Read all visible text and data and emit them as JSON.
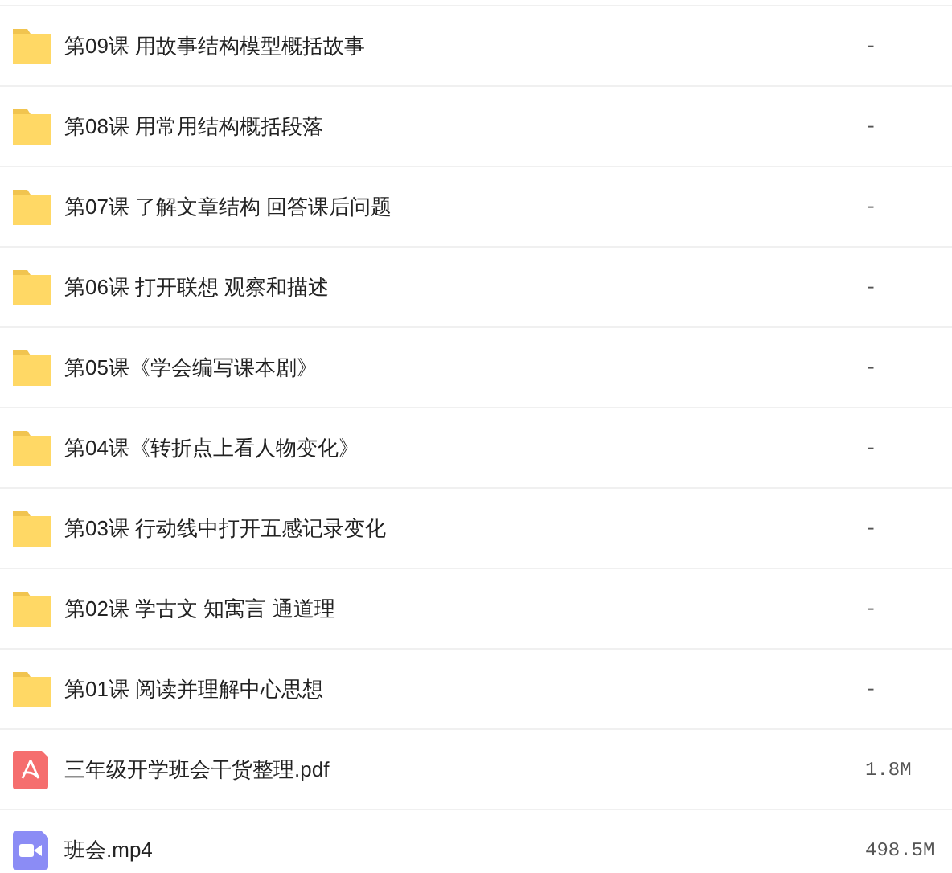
{
  "files": [
    {
      "kind": "folder",
      "name": "第09课 用故事结构模型概括故事",
      "size": "-"
    },
    {
      "kind": "folder",
      "name": "第08课 用常用结构概括段落",
      "size": "-"
    },
    {
      "kind": "folder",
      "name": "第07课 了解文章结构 回答课后问题",
      "size": "-"
    },
    {
      "kind": "folder",
      "name": "第06课 打开联想 观察和描述",
      "size": "-"
    },
    {
      "kind": "folder",
      "name": "第05课《学会编写课本剧》",
      "size": "-"
    },
    {
      "kind": "folder",
      "name": "第04课《转折点上看人物变化》",
      "size": "-"
    },
    {
      "kind": "folder",
      "name": "第03课 行动线中打开五感记录变化",
      "size": "-"
    },
    {
      "kind": "folder",
      "name": "第02课 学古文 知寓言 通道理",
      "size": "-"
    },
    {
      "kind": "folder",
      "name": "第01课 阅读并理解中心思想",
      "size": "-"
    },
    {
      "kind": "pdf",
      "name": "三年级开学班会干货整理.pdf",
      "size": "1.8M"
    },
    {
      "kind": "video",
      "name": "班会.mp4",
      "size": "498.5M"
    }
  ]
}
